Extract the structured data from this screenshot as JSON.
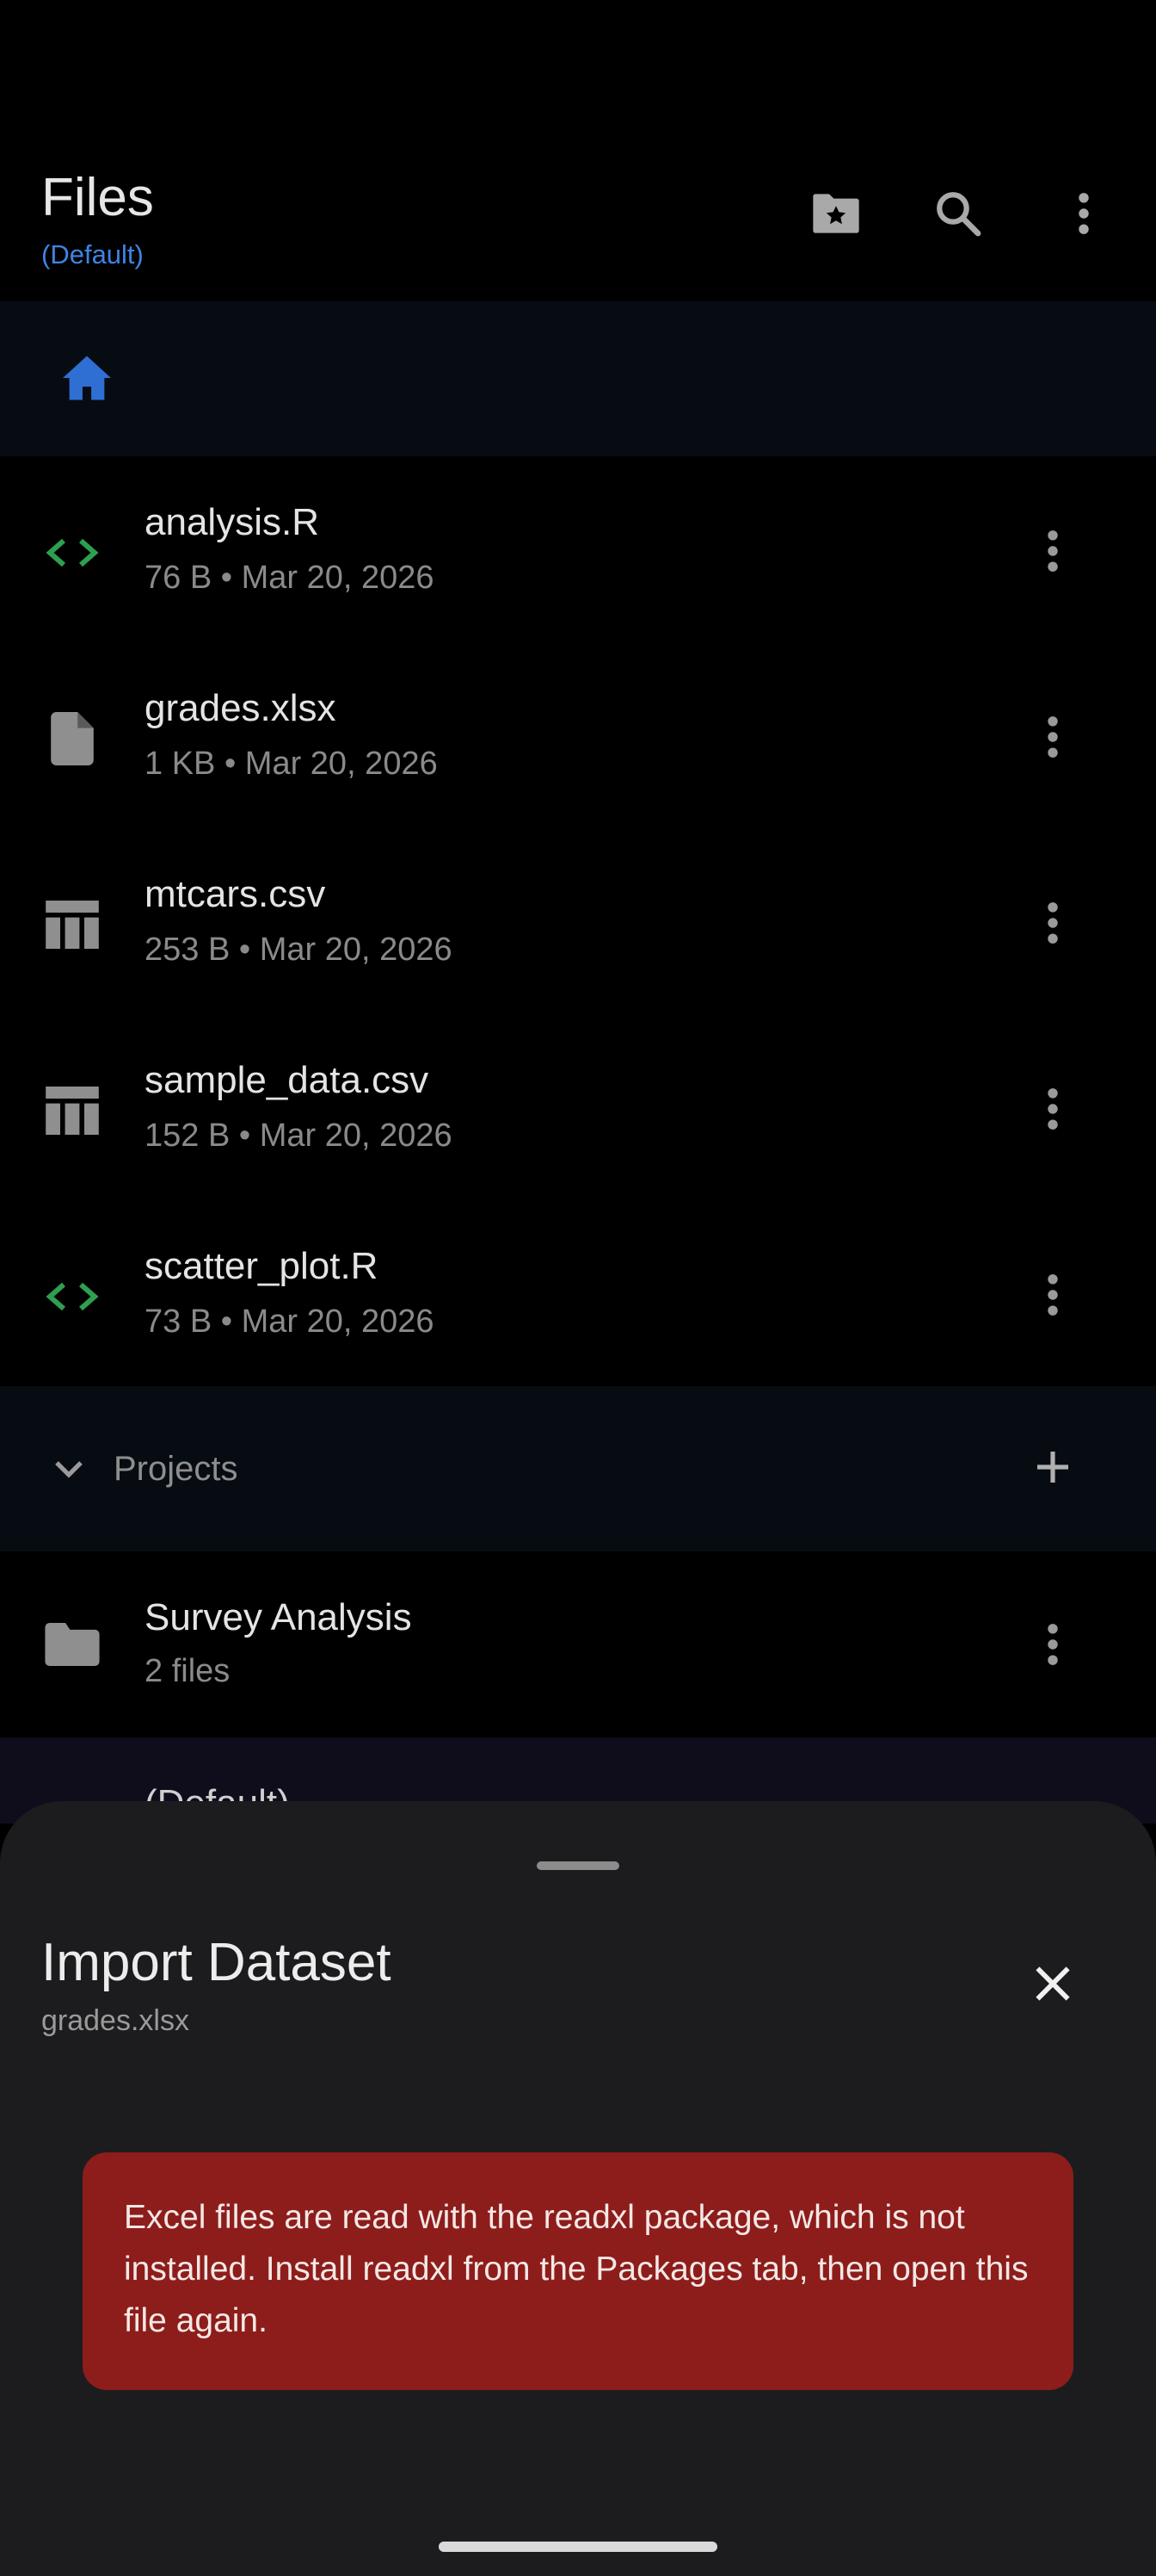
{
  "header": {
    "title": "Files",
    "subtitle": "(Default)",
    "subtitle_color": "#3f84e5"
  },
  "breadcrumb": {
    "icon": "home-icon",
    "icon_color": "#2f6fd4"
  },
  "files": [
    {
      "name": "analysis.R",
      "meta": "76 B • Mar 20, 2026",
      "icon": "code-icon"
    },
    {
      "name": "grades.xlsx",
      "meta": "1 KB • Mar 20, 2026",
      "icon": "document-icon"
    },
    {
      "name": "mtcars.csv",
      "meta": "253 B • Mar 20, 2026",
      "icon": "table-icon"
    },
    {
      "name": "sample_data.csv",
      "meta": "152 B • Mar 20, 2026",
      "icon": "table-icon"
    },
    {
      "name": "scatter_plot.R",
      "meta": "73 B • Mar 20, 2026",
      "icon": "code-icon"
    }
  ],
  "projects": {
    "label": "Projects",
    "items": [
      {
        "name": "Survey Analysis",
        "meta": "2 files",
        "icon": "folder-icon"
      }
    ],
    "peek_item": "(Default)"
  },
  "sheet": {
    "title": "Import Dataset",
    "subtitle": "grades.xlsx",
    "error_message": "Excel files are read with the readxl package, which is not installed. Install readxl from the Packages tab, then open this file again.",
    "error_color": "#8c1d1a"
  },
  "colors": {
    "code_icon": "#2e9e4f",
    "accent": "#3f84e5"
  }
}
